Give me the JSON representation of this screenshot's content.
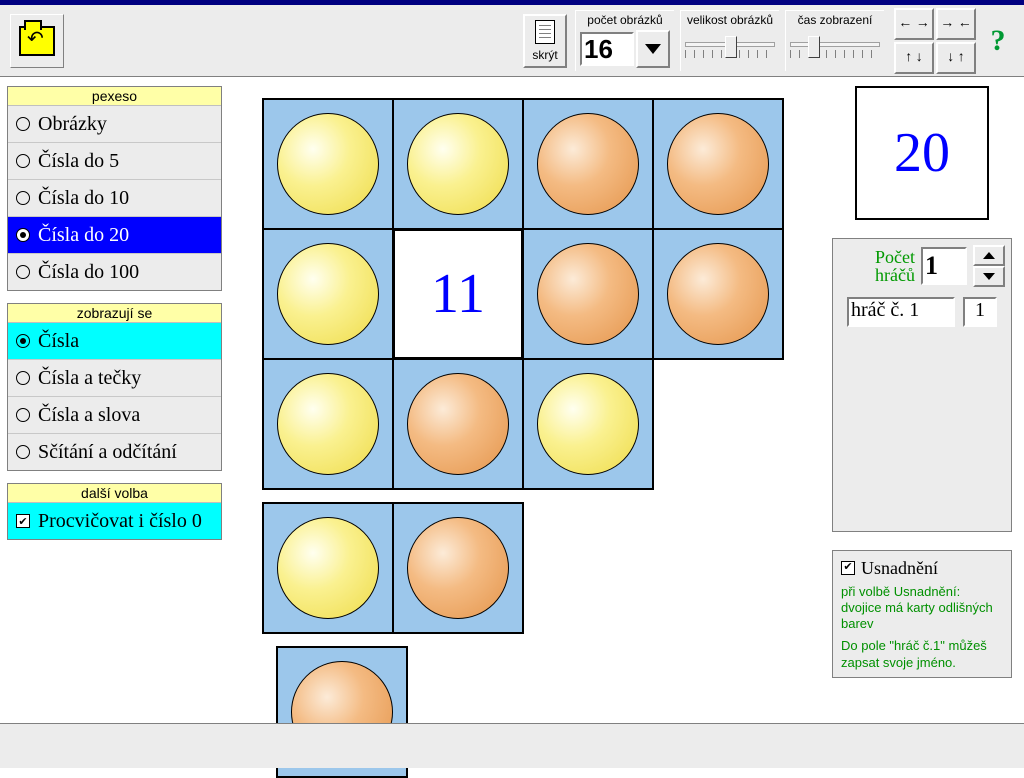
{
  "toolbar": {
    "hide_label": "skrýt",
    "count_caption": "počet obrázků",
    "count_value": "16",
    "size_caption": "velikost obrázků",
    "time_caption": "čas zobrazení"
  },
  "sidebar": {
    "panel1": {
      "title": "pexeso",
      "items": [
        {
          "label": "Obrázky",
          "selected": false
        },
        {
          "label": "Čísla do 5",
          "selected": false
        },
        {
          "label": "Čísla do 10",
          "selected": false
        },
        {
          "label": "Čísla do 20",
          "selected": true
        },
        {
          "label": "Čísla do 100",
          "selected": false
        }
      ]
    },
    "panel2": {
      "title": "zobrazují se",
      "items": [
        {
          "label": "Čísla",
          "selected": true
        },
        {
          "label": "Čísla a tečky",
          "selected": false
        },
        {
          "label": "Čísla a slova",
          "selected": false
        },
        {
          "label": "Sčítání a odčítání",
          "selected": false
        }
      ]
    },
    "panel3": {
      "title": "další volba",
      "items": [
        {
          "label": "Procvičovat i číslo 0",
          "checked": true
        }
      ]
    }
  },
  "board": {
    "revealed_value": "11",
    "cards": [
      {
        "kind": "ball",
        "color": "yellow"
      },
      {
        "kind": "ball",
        "color": "yellow"
      },
      {
        "kind": "ball",
        "color": "orange"
      },
      {
        "kind": "ball",
        "color": "orange"
      },
      {
        "kind": "ball",
        "color": "yellow"
      },
      {
        "kind": "reveal",
        "value": "11"
      },
      {
        "kind": "ball",
        "color": "orange"
      },
      {
        "kind": "ball",
        "color": "orange"
      },
      {
        "kind": "ball",
        "color": "yellow"
      },
      {
        "kind": "ball",
        "color": "orange"
      },
      {
        "kind": "ball",
        "color": "yellow"
      },
      {
        "kind": "gap"
      },
      {
        "kind": "ball",
        "color": "yellow"
      },
      {
        "kind": "ball",
        "color": "orange"
      },
      {
        "kind": "gap"
      },
      {
        "kind": "ball",
        "color": "orange",
        "detached": true
      }
    ]
  },
  "right": {
    "display_value": "20",
    "players_count_label": "Počet\nhráčů",
    "players_count_value": "1",
    "player_name": "hráč č. 1",
    "player_score": "1",
    "easy_label": "Usnadnění",
    "easy_checked": true,
    "hint1": "při volbě Usnadnění: dvojice má karty odlišných barev",
    "hint2": "Do pole \"hráč č.1\" můžeš zapsat svoje jméno."
  }
}
